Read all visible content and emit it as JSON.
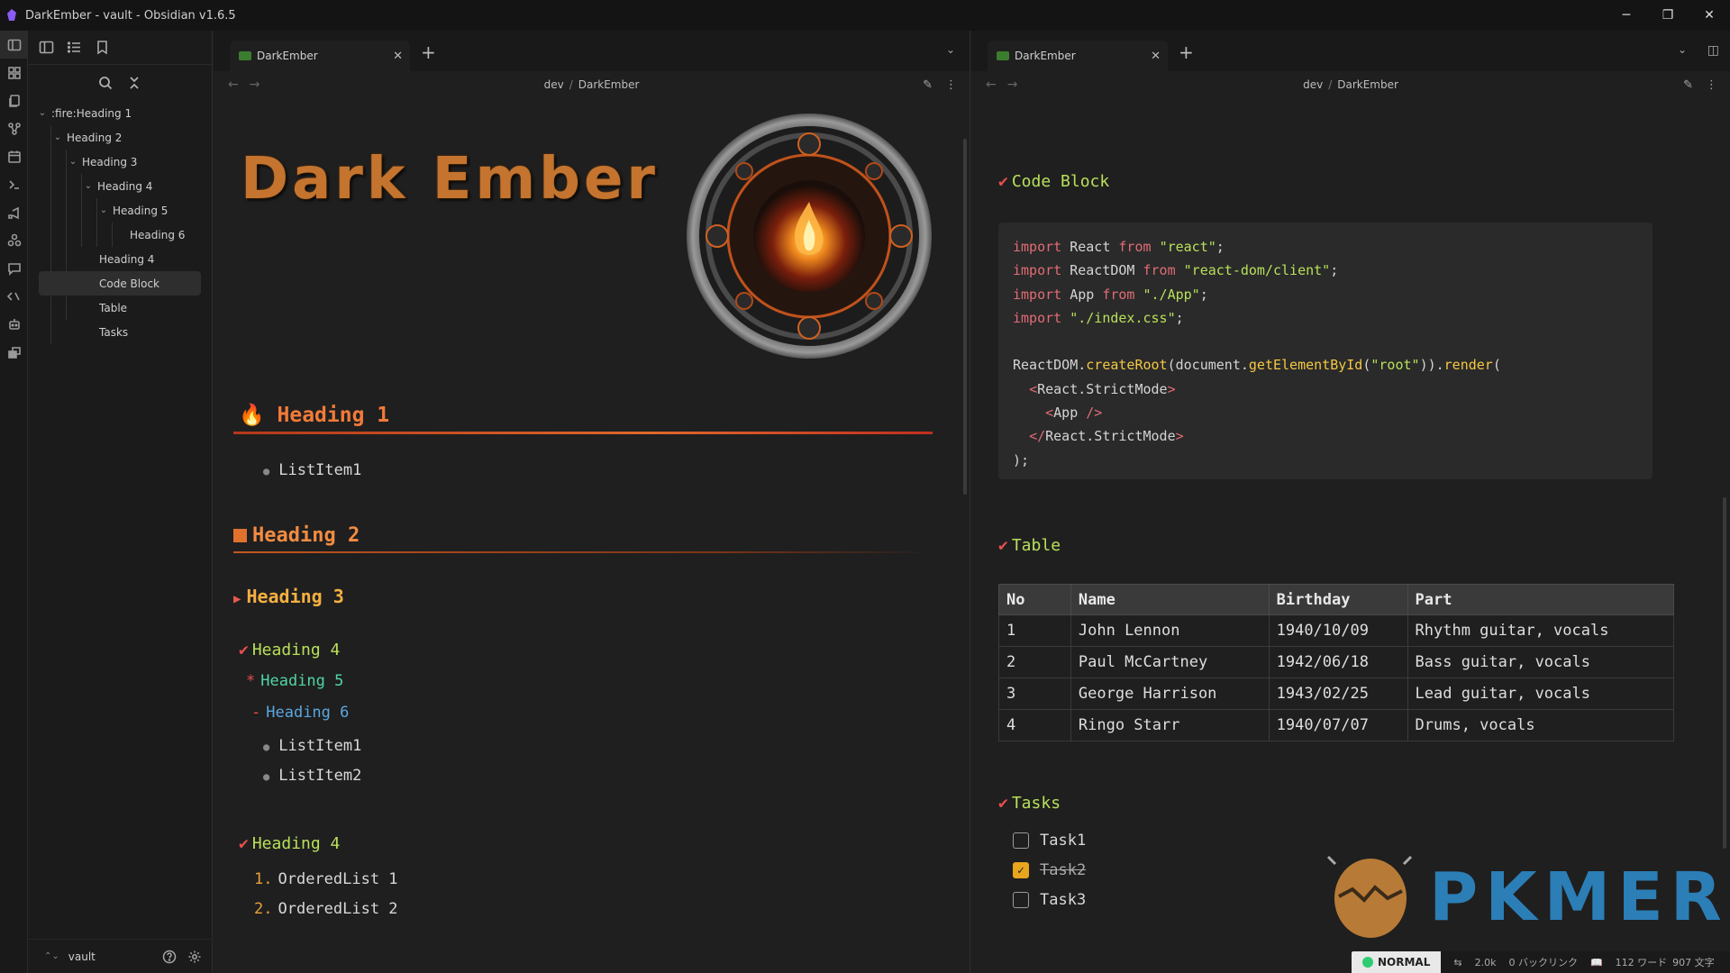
{
  "window": {
    "title": "DarkEmber - vault - Obsidian v1.6.5",
    "controls": {
      "minimize": "─",
      "restore": "❐",
      "close": "✕"
    }
  },
  "sidebar": {
    "outline": [
      {
        "label": ":fire:Heading 1",
        "level": 1,
        "collapsible": true
      },
      {
        "label": "Heading 2",
        "level": 2,
        "collapsible": true
      },
      {
        "label": "Heading 3",
        "level": 3,
        "collapsible": true
      },
      {
        "label": "Heading 4",
        "level": 4,
        "collapsible": true
      },
      {
        "label": "Heading 5",
        "level": 5,
        "collapsible": true
      },
      {
        "label": "Heading 6",
        "level": 6,
        "collapsible": false
      },
      {
        "label": "Heading 4",
        "level": 4,
        "collapsible": false
      },
      {
        "label": "Code Block",
        "level": 4,
        "collapsible": false,
        "active": true
      },
      {
        "label": "Table",
        "level": 4,
        "collapsible": false
      },
      {
        "label": "Tasks",
        "level": 4,
        "collapsible": false
      }
    ],
    "vault_name": "vault"
  },
  "left_pane": {
    "tab_label": "DarkEmber",
    "breadcrumb_folder": "dev",
    "breadcrumb_separator": "/",
    "breadcrumb_file": "DarkEmber",
    "banner_title": "Dark Ember",
    "heading1": "Heading 1",
    "h1_list": [
      "ListItem1"
    ],
    "heading2": "Heading 2",
    "heading3": "Heading 3",
    "heading4a": "Heading 4",
    "heading5": "Heading 5",
    "heading6": "Heading 6",
    "h6_list": [
      "ListItem1",
      "ListItem2"
    ],
    "heading4b": "Heading 4",
    "ordered_list": [
      {
        "num": "1.",
        "text": "OrderedList 1"
      },
      {
        "num": "2.",
        "text": "OrderedList 2"
      }
    ]
  },
  "right_pane": {
    "tab_label": "DarkEmber",
    "breadcrumb_folder": "dev",
    "breadcrumb_separator": "/",
    "breadcrumb_file": "DarkEmber",
    "code_heading": "Code Block",
    "code_lines": [
      "import React from \"react\";",
      "import ReactDOM from \"react-dom/client\";",
      "import App from \"./App\";",
      "import \"./index.css\";",
      "",
      "ReactDOM.createRoot(document.getElementById(\"root\")).render(",
      "  <React.StrictMode>",
      "    <App />",
      "  </React.StrictMode>",
      ");"
    ],
    "table_heading": "Table",
    "table": {
      "columns": [
        "No",
        "Name",
        "Birthday",
        "Part"
      ],
      "rows": [
        [
          "1",
          "John Lennon",
          "1940/10/09",
          "Rhythm guitar, vocals"
        ],
        [
          "2",
          "Paul McCartney",
          "1942/06/18",
          "Bass guitar, vocals"
        ],
        [
          "3",
          "George Harrison",
          "1943/02/25",
          "Lead guitar, vocals"
        ],
        [
          "4",
          "Ringo Starr",
          "1940/07/07",
          "Drums, vocals"
        ]
      ]
    },
    "tasks_heading": "Tasks",
    "tasks": [
      {
        "label": "Task1",
        "done": false
      },
      {
        "label": "Task2",
        "done": true
      },
      {
        "label": "Task3",
        "done": false
      }
    ]
  },
  "statusbar": {
    "mode": "NORMAL",
    "count": "2.0k",
    "backlinks": "0 バックリンク",
    "words": "112 ワード",
    "chars": "907 文字"
  },
  "watermark": "PKMER",
  "colors": {
    "accent_orange": "#f27a38",
    "heading3": "#f5b041",
    "heading4": "#b8e05a",
    "heading5": "#4fd6a3",
    "heading6": "#5aa7e0",
    "check_red": "#e84e4e",
    "task_checked": "#e8a51e"
  }
}
